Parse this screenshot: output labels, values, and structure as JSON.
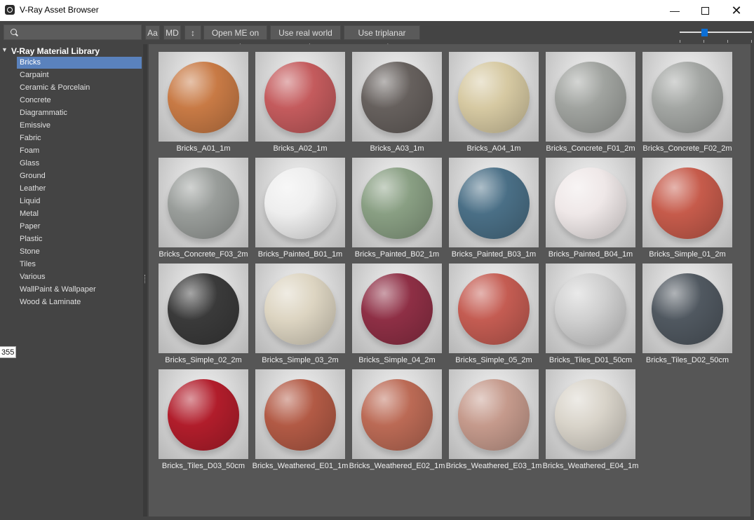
{
  "window": {
    "title": "V-Ray Asset Browser",
    "controls": {
      "minimize": "—",
      "close": "✕"
    }
  },
  "toolbar": {
    "search_placeholder": "",
    "buttons": [
      "Aa",
      "MD",
      "↕",
      "Open ME on apply",
      "Use real world scale",
      "Use triplanar mapping"
    ]
  },
  "slider": {
    "value": 0.33
  },
  "library": {
    "title": "V-Ray Material Library",
    "items": [
      "Bricks",
      "Carpaint",
      "Ceramic & Porcelain",
      "Concrete",
      "Diagrammatic",
      "Emissive",
      "Fabric",
      "Foam",
      "Glass",
      "Ground",
      "Leather",
      "Liquid",
      "Metal",
      "Paper",
      "Plastic",
      "Stone",
      "Tiles",
      "Various",
      "WallPaint & Wallpaper",
      "Wood & Laminate"
    ],
    "selected": 0
  },
  "tooltip": "355",
  "materials": [
    {
      "name": "Bricks_A01_1m",
      "color": "#c87a45"
    },
    {
      "name": "Bricks_A02_1m",
      "color": "#c45b5d"
    },
    {
      "name": "Bricks_A03_1m",
      "color": "#66605d"
    },
    {
      "name": "Bricks_A04_1m",
      "color": "#d6c9a2"
    },
    {
      "name": "Bricks_Concrete_F01_2m",
      "color": "#a0a39f"
    },
    {
      "name": "Bricks_Concrete_F02_2m",
      "color": "#a3a6a3"
    },
    {
      "name": "Bricks_Concrete_F03_2m",
      "color": "#999d9a"
    },
    {
      "name": "Bricks_Painted_B01_1m",
      "color": "#eeeeee"
    },
    {
      "name": "Bricks_Painted_B02_1m",
      "color": "#899f83"
    },
    {
      "name": "Bricks_Painted_B03_1m",
      "color": "#4a6f86"
    },
    {
      "name": "Bricks_Painted_B04_1m",
      "color": "#efe8e8"
    },
    {
      "name": "Bricks_Simple_01_2m",
      "color": "#c65b4b"
    },
    {
      "name": "Bricks_Simple_02_2m",
      "color": "#3a3a3a"
    },
    {
      "name": "Bricks_Simple_03_2m",
      "color": "#ddd5c2"
    },
    {
      "name": "Bricks_Simple_04_2m",
      "color": "#8e2f45"
    },
    {
      "name": "Bricks_Simple_05_2m",
      "color": "#c45c52"
    },
    {
      "name": "Bricks_Tiles_D01_50cm",
      "color": "#d0d0d0"
    },
    {
      "name": "Bricks_Tiles_D02_50cm",
      "color": "#505860"
    },
    {
      "name": "Bricks_Tiles_D03_50cm",
      "color": "#b11d2b"
    },
    {
      "name": "Bricks_Weathered_E01_1m",
      "color": "#b25a45"
    },
    {
      "name": "Bricks_Weathered_E02_1m",
      "color": "#bb6a55"
    },
    {
      "name": "Bricks_Weathered_E03_1m",
      "color": "#c59a8c"
    },
    {
      "name": "Bricks_Weathered_E04_1m",
      "color": "#d9d4ca"
    }
  ]
}
